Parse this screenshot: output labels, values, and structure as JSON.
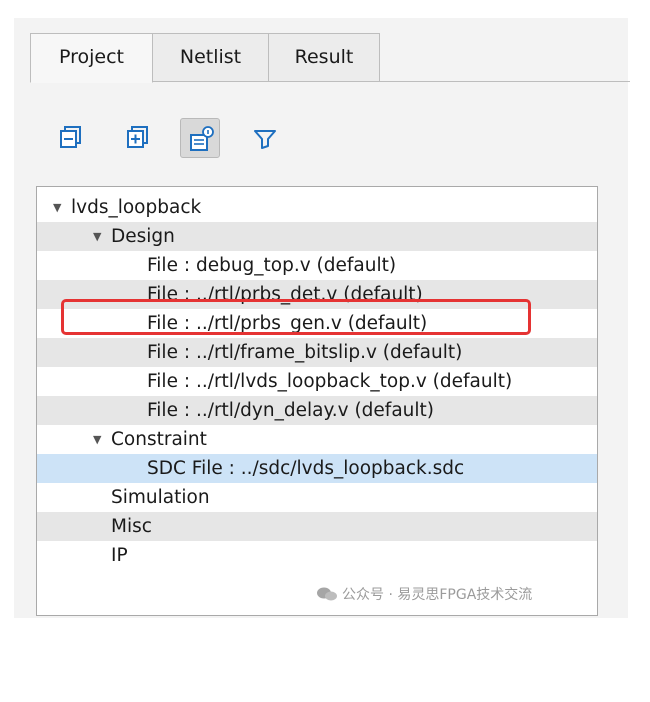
{
  "tabs": [
    {
      "label": "Project",
      "active": true
    },
    {
      "label": "Netlist",
      "active": false
    },
    {
      "label": "Result",
      "active": false
    }
  ],
  "toolbar": {
    "icons": [
      "collapse-all-icon",
      "expand-all-icon",
      "show-properties-icon",
      "filter-icon"
    ],
    "pressed": "show-properties-icon"
  },
  "tree": {
    "root": "lvds_loopback",
    "design_label": "Design",
    "design_files": [
      "File : debug_top.v (default)",
      "File : ../rtl/prbs_det.v (default)",
      "File : ../rtl/prbs_gen.v (default)",
      "File : ../rtl/frame_bitslip.v (default)",
      "File : ../rtl/lvds_loopback_top.v (default)",
      "File : ../rtl/dyn_delay.v (default)"
    ],
    "constraint_label": "Constraint",
    "sdc_file": "SDC File : ../sdc/lvds_loopback.sdc",
    "simulation_label": "Simulation",
    "misc_label": "Misc",
    "ip_label": "IP"
  },
  "watermark": {
    "text": "公众号 · 易灵思FPGA技术交流"
  },
  "colors": {
    "selection": "#cde3f7",
    "highlight": "#e53333",
    "alt_row": "#e6e6e6",
    "icon_blue": "#1e6fbf"
  }
}
